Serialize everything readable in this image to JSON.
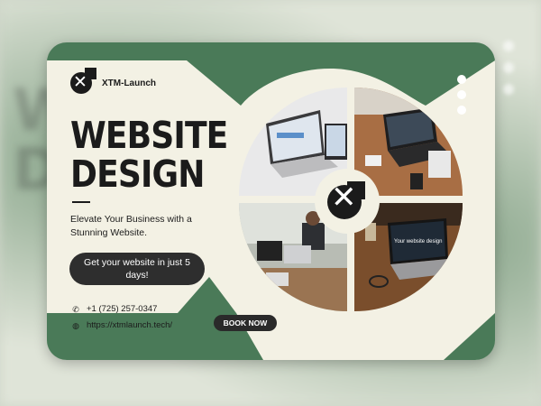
{
  "brand": {
    "name": "XTM-Launch"
  },
  "headline": {
    "line1": "WEBSITE",
    "line2": "DESIGN"
  },
  "tagline": "Elevate Your Business with a Stunning Website.",
  "promo": "Get your website in just 5 days!",
  "contact": {
    "phone": "+1 (725) 257-0347",
    "website": "https://xtmlaunch.tech/"
  },
  "cta": {
    "label": "BOOK NOW"
  },
  "photos": {
    "screen_text": "Your website design"
  },
  "icons": {
    "phone": "phone-icon",
    "globe": "globe-icon",
    "logo": "x-logo-icon",
    "menu": "dots-menu-icon"
  },
  "colors": {
    "green": "#4a7a58",
    "cream": "#f3f1e4",
    "dark": "#1b1b1b"
  }
}
